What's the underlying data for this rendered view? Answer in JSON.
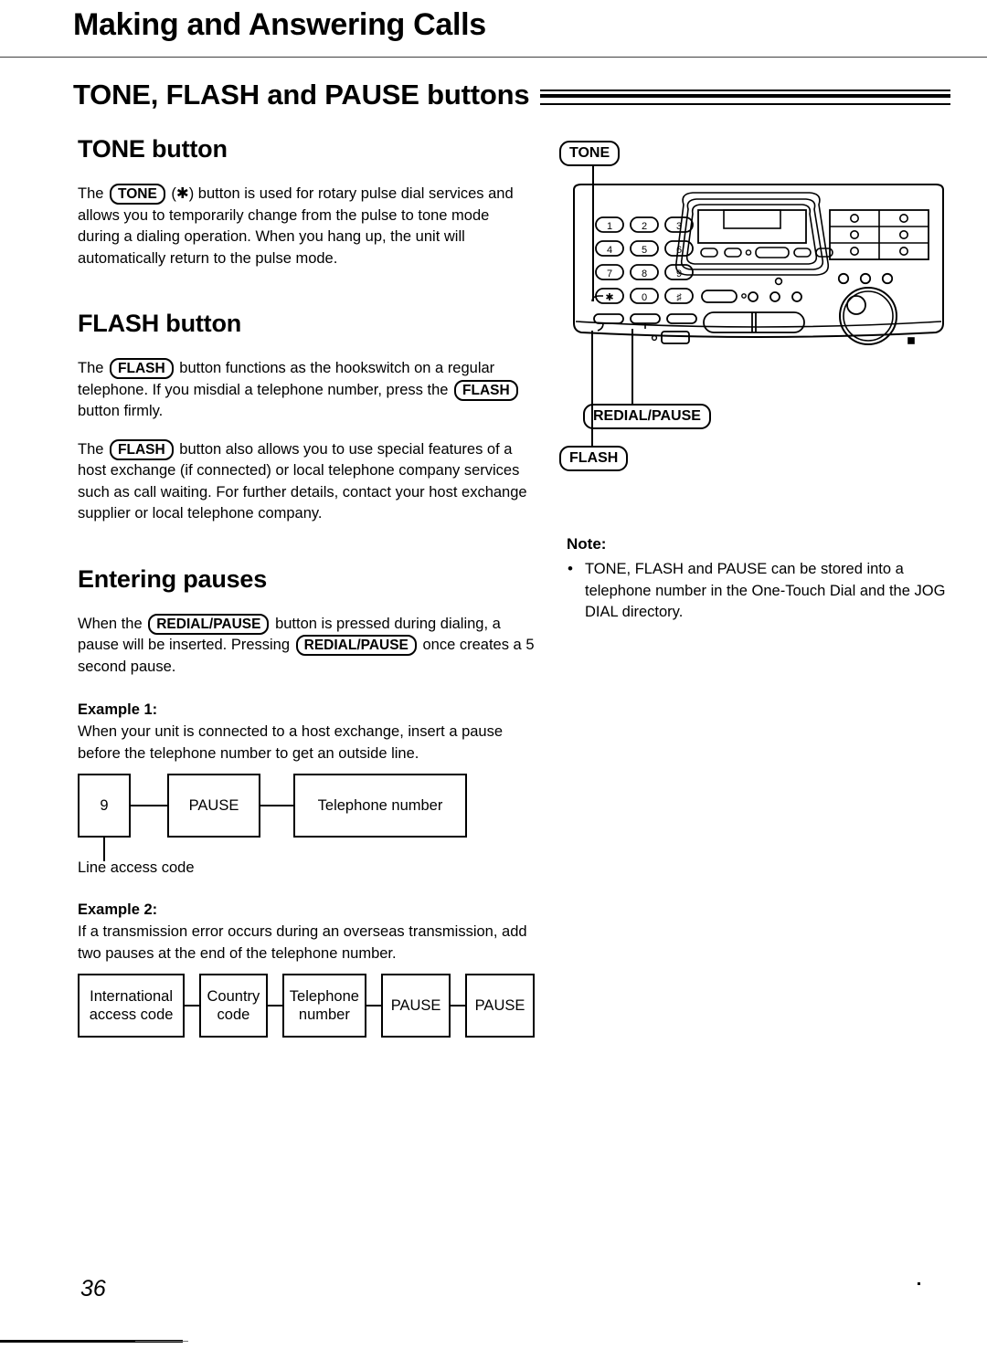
{
  "page": {
    "chapter_title": "Making and Answering Calls",
    "section_title": "TONE, FLASH and PAUSE buttons",
    "page_number": "36"
  },
  "tone_section": {
    "heading": "TONE button",
    "para_1_a": "The",
    "key_tone": "TONE",
    "para_1_b": "(✱) button is used for rotary pulse dial services and allows you to temporarily change from the pulse to tone mode during a dialing operation. When you hang up, the unit will automatically return to the pulse mode."
  },
  "flash_section": {
    "heading": "FLASH button",
    "key_flash": "FLASH",
    "para_1_a": "The",
    "para_1_b": "button functions as the hookswitch on a regular telephone. If you misdial a telephone number, press the",
    "para_1_c": "button firmly.",
    "para_2_a": "The",
    "para_2_b": "button also allows you to use special features of a host exchange (if connected) or local telephone company services such as call waiting. For further details, contact your host exchange supplier or local telephone company."
  },
  "pauses_section": {
    "heading": "Entering pauses",
    "key_redial_pause": "REDIAL/PAUSE",
    "intro_a": "When the",
    "intro_b": "button is pressed during dialing, a pause will be inserted. Pressing",
    "intro_c": "once creates a 5 second pause.",
    "example_1": {
      "label": "Example 1:",
      "text": "When your unit is connected to a host exchange, insert a pause before the telephone number to get an outside line.",
      "boxes": [
        "9",
        "PAUSE",
        "Telephone number"
      ],
      "annotation": "Line access code"
    },
    "example_2": {
      "label": "Example 2:",
      "text": "If a transmission error occurs during an overseas transmission, add two pauses at the end of the telephone number.",
      "boxes": [
        "International access code",
        "Country code",
        "Telephone number",
        "PAUSE",
        "PAUSE"
      ]
    }
  },
  "illustration": {
    "callouts": {
      "tone": "TONE",
      "redial_pause": "REDIAL/PAUSE",
      "flash": "FLASH"
    },
    "keypad": [
      [
        "1",
        "2",
        "3"
      ],
      [
        "4",
        "5",
        "6"
      ],
      [
        "7",
        "8",
        "9"
      ],
      [
        "✱",
        "0",
        "♯"
      ]
    ]
  },
  "note": {
    "title": "Note:",
    "items": [
      "TONE, FLASH and PAUSE can be stored into a telephone number in the One-Touch Dial and the JOG DIAL directory."
    ]
  }
}
